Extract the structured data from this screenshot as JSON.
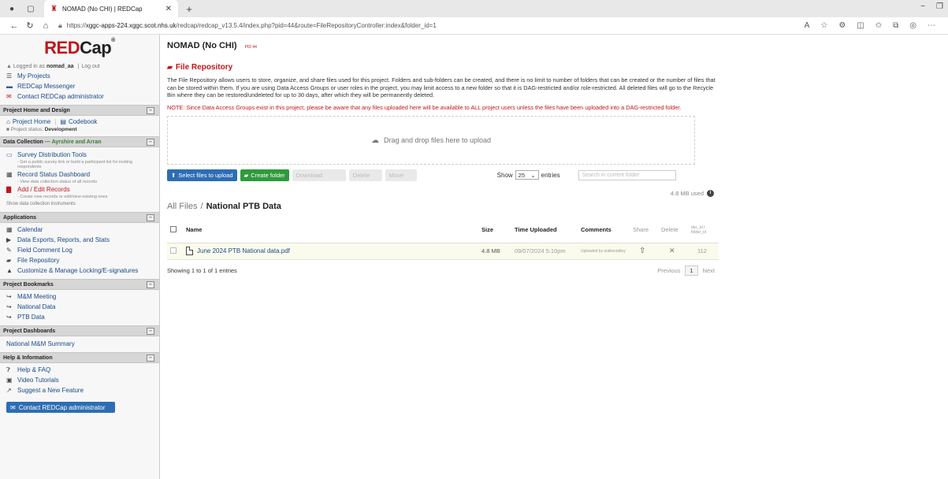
{
  "browser": {
    "tab_title": "NOMAD (No CHI) | REDCap",
    "url_prefix": "https://",
    "url_host": "xggc-apps-224.xggc.scot.nhs.uk",
    "url_path": "/redcap/redcap_v13.5.4/index.php?pid=44&route=FileRepositoryController:index&folder_id=1"
  },
  "sidebar": {
    "logo_red": "RED",
    "logo_rest": "Cap",
    "logged_prefix": "Logged in as",
    "username": "nomad_aa",
    "logout": "Log out",
    "top_links": [
      "My Projects",
      "REDCap Messenger",
      "Contact REDCap administrator"
    ],
    "project_home_header": "Project Home and Design",
    "project_home": "Project Home",
    "codebook": "Codebook",
    "status_label": "Project status:",
    "status_value": "Development",
    "data_collection_header": "Data Collection",
    "data_collection_group": "— Ayrshire and Arran",
    "survey_tools": "Survey Distribution Tools",
    "survey_note": "- Get a public survey link or build a participant list for inviting respondents",
    "record_status": "Record Status Dashboard",
    "record_status_note": "- View data collection status of all records",
    "add_edit": "Add / Edit Records",
    "add_edit_note": "- Create new records or edit/view existing ones",
    "show_instruments": "Show data collection instruments",
    "applications_header": "Applications",
    "applications": [
      "Calendar",
      "Data Exports, Reports, and Stats",
      "Field Comment Log",
      "File Repository",
      "Customize & Manage Locking/E-signatures"
    ],
    "bookmarks_header": "Project Bookmarks",
    "bookmarks": [
      "M&M Meeting",
      "National Data",
      "PTB Data"
    ],
    "dashboards_header": "Project Dashboards",
    "dashboards": [
      "National M&M Summary"
    ],
    "help_header": "Help & Information",
    "help_links": [
      "Help & FAQ",
      "Video Tutorials",
      "Suggest a New Feature"
    ],
    "contact_button": "Contact REDCap administrator"
  },
  "main": {
    "project_title": "NOMAD (No CHI)",
    "pid": "PID 44",
    "page_heading": "File Repository",
    "description": "The File Repository allows users to store, organize, and share files used for this project. Folders and sub-folders can be created, and there is no limit to number of folders that can be created or the number of files that can be stored within them. If you are using Data Access Groups or user roles in the project, you may limit access to a new folder so that it is DAG-restricted and/or role-restricted. All deleted files will go to the Recycle Bin where they can be restored/undeleted for up to 30 days, after which they will be permanently deleted.",
    "note": "NOTE: Since Data Access Groups exist in this project, please be aware that any files uploaded here will be available to ALL project users unless the files have been uploaded into a DAG-restricted folder.",
    "dropzone": "Drag and drop files here to upload",
    "btn_select": "Select files to upload",
    "btn_create_folder": "Create folder",
    "btn_download": "Download",
    "btn_delete": "Delete",
    "btn_move": "Move",
    "show_label": "Show",
    "show_value": "25",
    "entries_label": "entries",
    "search_placeholder": "Search in current folder",
    "mb_used": "4.8 MB used",
    "crumb_root": "All Files",
    "crumb_current": "National PTB Data",
    "columns": {
      "name": "Name",
      "size": "Size",
      "time": "Time Uploaded",
      "comments": "Comments",
      "share": "Share",
      "delete": "Delete",
      "id": "doc_id / folder_id"
    },
    "rows": [
      {
        "name": "June 2024 PTB National data.pdf",
        "size": "4.8 MB",
        "time": "09/07/2024 5:10pm",
        "comment": "Uploaded by niallwoodley",
        "id": "112"
      }
    ],
    "showing": "Showing 1 to 1 of 1 entries",
    "pager_prev": "Previous",
    "pager_page": "1",
    "pager_next": "Next"
  }
}
